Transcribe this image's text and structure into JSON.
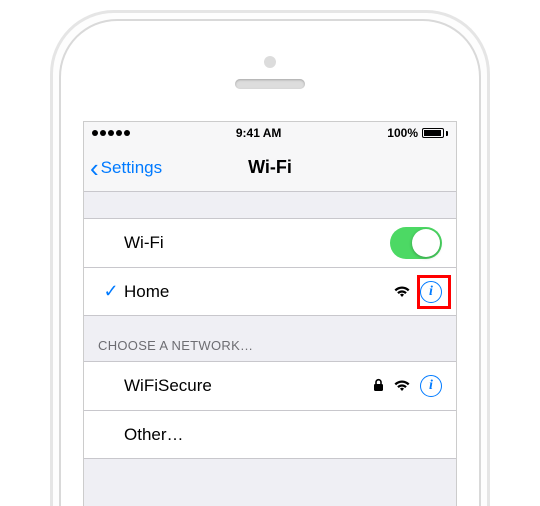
{
  "statusbar": {
    "time": "9:41 AM",
    "battery_pct": "100%"
  },
  "navbar": {
    "back_label": "Settings",
    "title": "Wi-Fi"
  },
  "wifi_toggle": {
    "label": "Wi-Fi",
    "on": true
  },
  "connected_network": {
    "name": "Home"
  },
  "section_header": "CHOOSE A NETWORK…",
  "networks": [
    {
      "name": "WiFiSecure",
      "locked": true
    }
  ],
  "other_label": "Other…",
  "info_glyph": "i"
}
